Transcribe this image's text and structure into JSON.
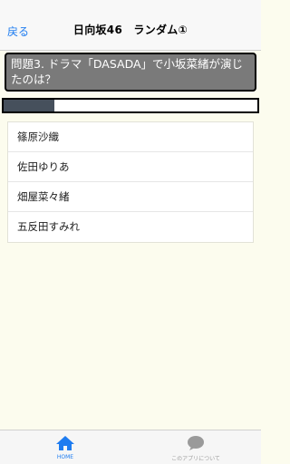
{
  "nav": {
    "back_label": "戻る",
    "title": "日向坂46　ランダム①"
  },
  "question": {
    "text": "問題3. ドラマ「DASADA」で小坂菜緒が演じたのは？"
  },
  "progress": {
    "fraction": 0.2
  },
  "answers": [
    {
      "label": "篠原沙織"
    },
    {
      "label": "佐田ゆりあ"
    },
    {
      "label": "畑屋菜々緒"
    },
    {
      "label": "五反田すみれ"
    }
  ],
  "tabbar": {
    "items": [
      {
        "label": "HOME",
        "icon": "home-icon",
        "active": true
      },
      {
        "label": "このアプリについて",
        "icon": "speech-bubble-icon",
        "active": false
      }
    ]
  },
  "colors": {
    "accent": "#1E7CF0",
    "background": "#FCFCEE",
    "question_bg": "#7A7A7A",
    "progress_fill": "#46505C"
  }
}
